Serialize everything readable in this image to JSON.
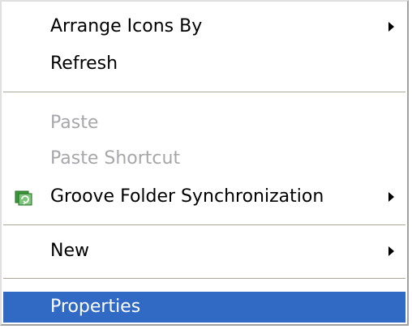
{
  "menu": {
    "items": [
      {
        "label": "Arrange Icons By",
        "submenu": true,
        "enabled": true
      },
      {
        "label": "Refresh",
        "submenu": false,
        "enabled": true
      },
      {
        "label": "Paste",
        "submenu": false,
        "enabled": false
      },
      {
        "label": "Paste Shortcut",
        "submenu": false,
        "enabled": false
      },
      {
        "label": "Groove Folder Synchronization",
        "submenu": true,
        "enabled": true,
        "icon": "groove-icon"
      },
      {
        "label": "New",
        "submenu": true,
        "enabled": true
      },
      {
        "label": "Properties",
        "submenu": false,
        "enabled": true,
        "selected": true
      }
    ]
  },
  "colors": {
    "selection": "#316ac5",
    "disabled_text": "#a7a6aa",
    "separator": "#aca899",
    "groove_green": "#3c9a3c"
  }
}
